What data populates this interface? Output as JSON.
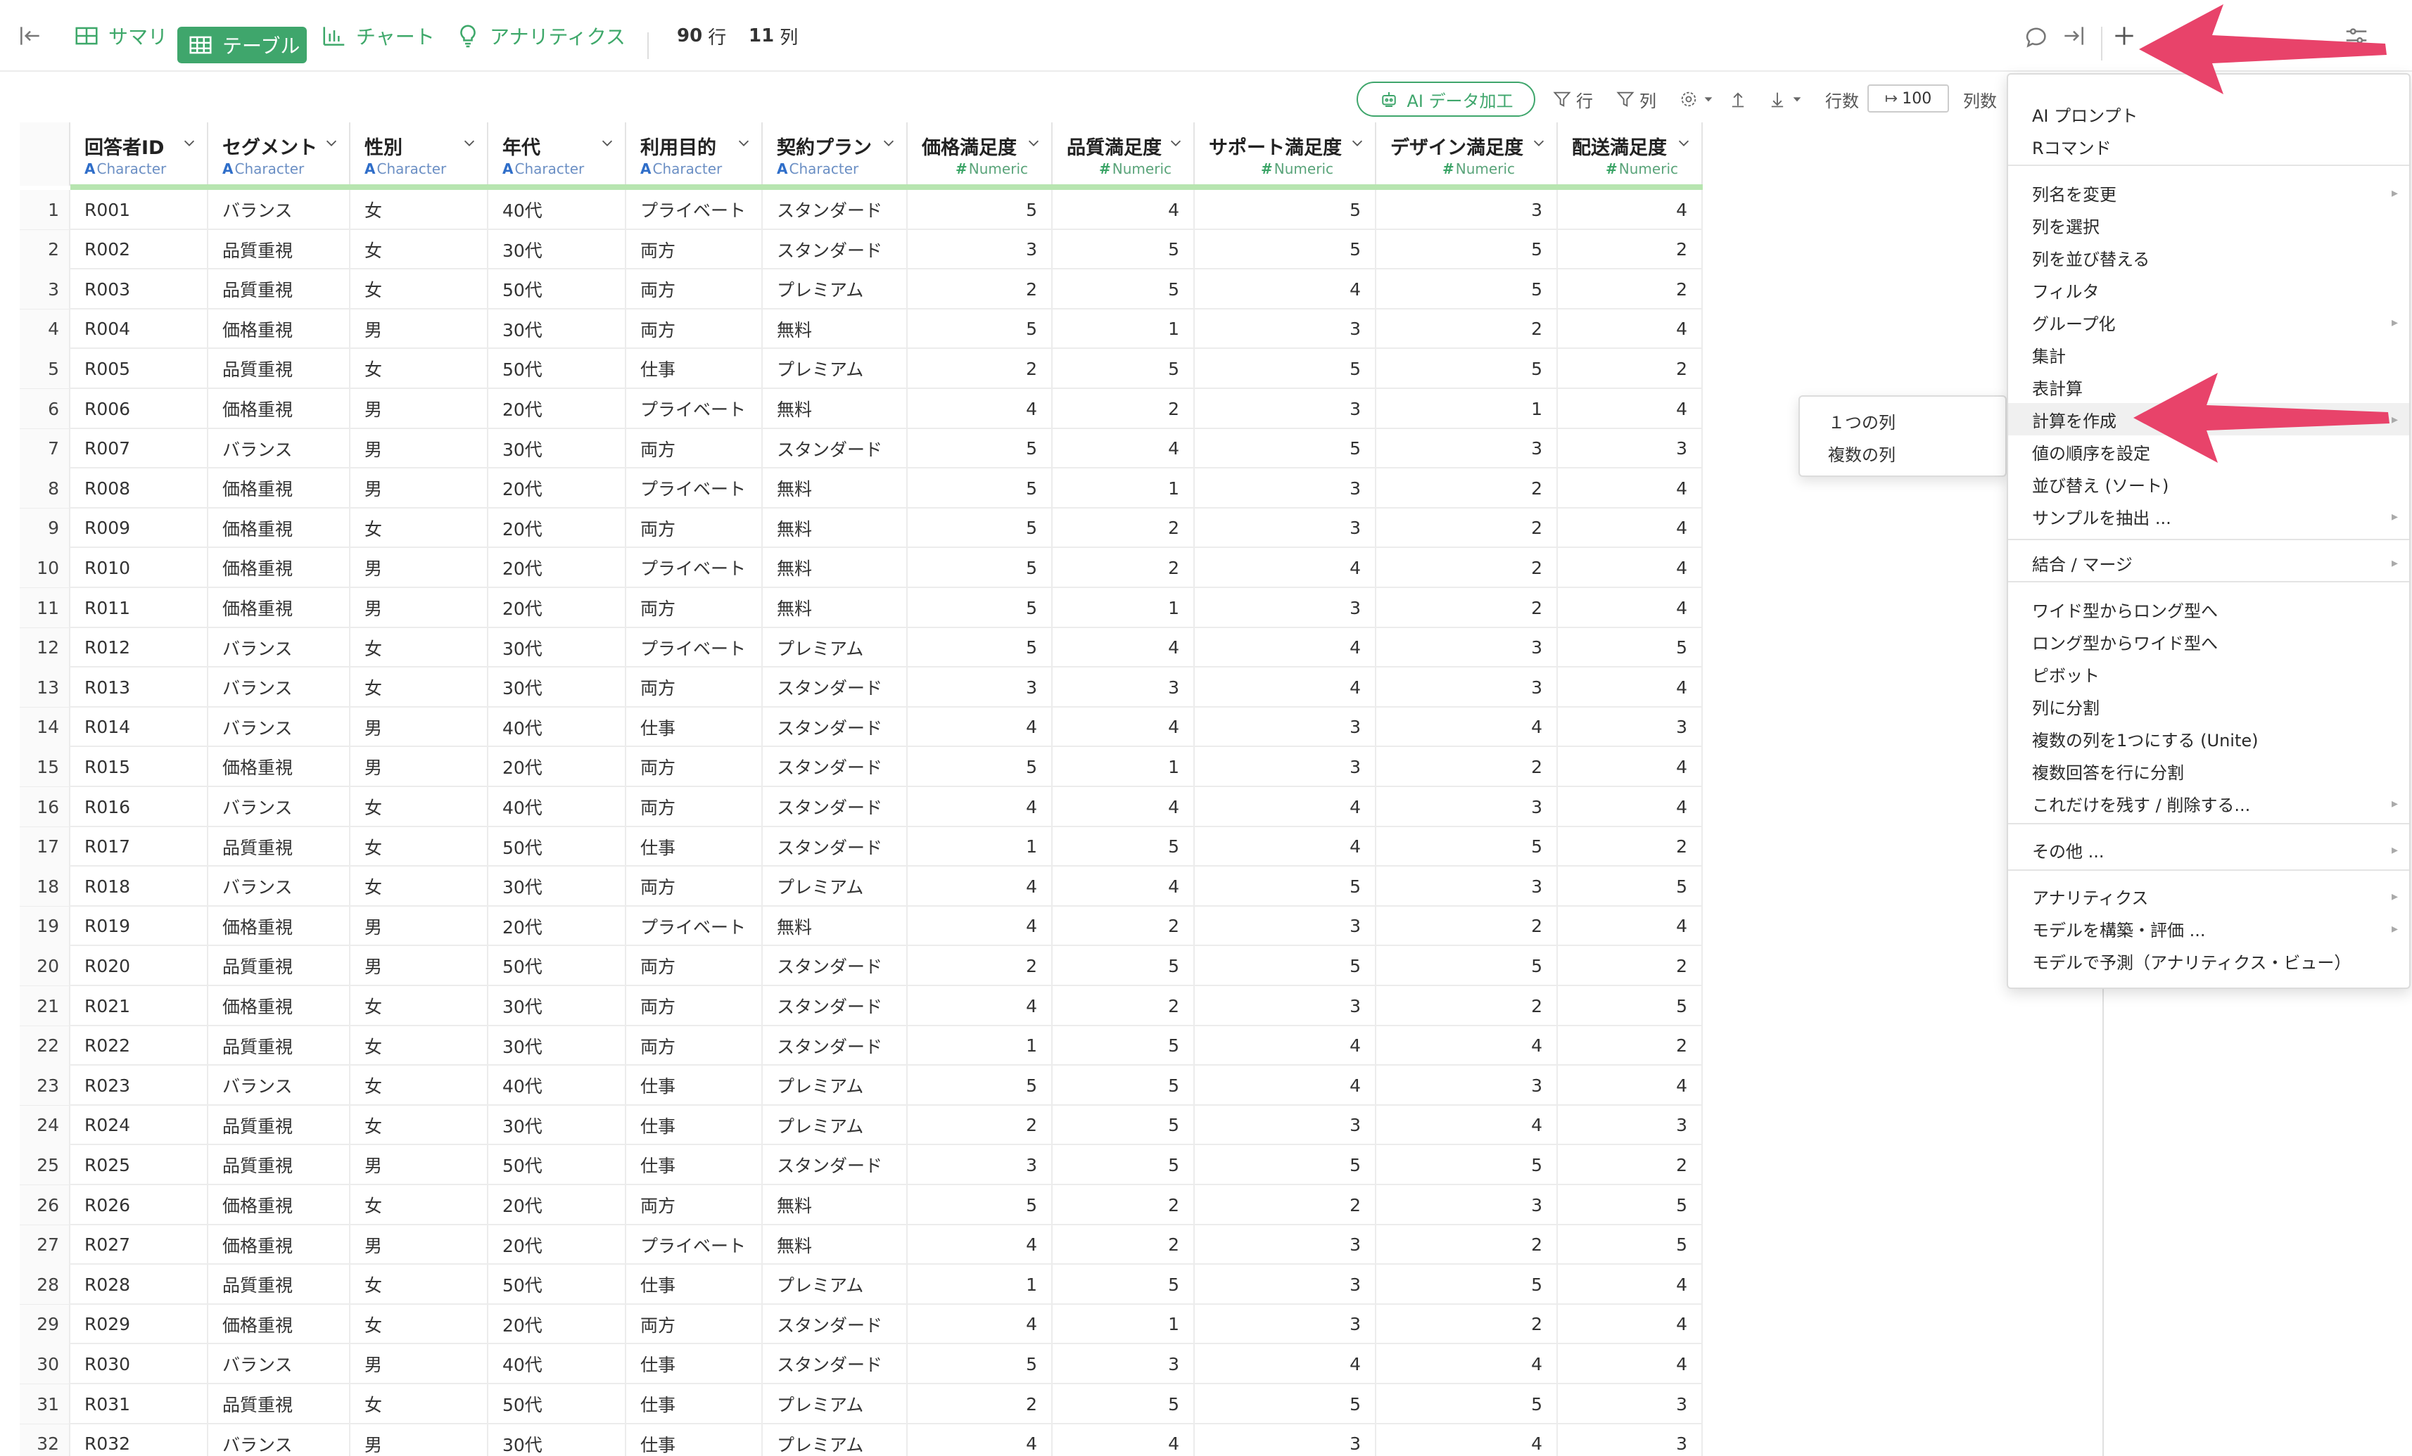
{
  "toolbar": {
    "summary_label": "サマリ",
    "table_label": "テーブル",
    "chart_label": "チャート",
    "analytics_label": "アナリティクス",
    "row_count": "90",
    "row_unit": "行",
    "col_count": "11",
    "col_unit": "列"
  },
  "toolbar2": {
    "ai_label": "AI データ加工",
    "filter_row": "行",
    "filter_col": "列",
    "rows_label": "行数",
    "rows_value": "100",
    "cols_label": "列数"
  },
  "columns": [
    {
      "name": "回答者ID",
      "type": "Character"
    },
    {
      "name": "セグメント",
      "type": "Character"
    },
    {
      "name": "性別",
      "type": "Character"
    },
    {
      "name": "年代",
      "type": "Character"
    },
    {
      "name": "利用目的",
      "type": "Character"
    },
    {
      "name": "契約プラン",
      "type": "Character"
    },
    {
      "name": "価格満足度",
      "type": "Numeric"
    },
    {
      "name": "品質満足度",
      "type": "Numeric"
    },
    {
      "name": "サポート満足度",
      "type": "Numeric"
    },
    {
      "name": "デザイン満足度",
      "type": "Numeric"
    },
    {
      "name": "配送満足度",
      "type": "Numeric"
    }
  ],
  "rows": [
    [
      "1",
      "R001",
      "バランス",
      "女",
      "40代",
      "プライベート",
      "スタンダード",
      "5",
      "4",
      "5",
      "3",
      "4"
    ],
    [
      "2",
      "R002",
      "品質重視",
      "女",
      "30代",
      "両方",
      "スタンダード",
      "3",
      "5",
      "5",
      "5",
      "2"
    ],
    [
      "3",
      "R003",
      "品質重視",
      "女",
      "50代",
      "両方",
      "プレミアム",
      "2",
      "5",
      "4",
      "5",
      "2"
    ],
    [
      "4",
      "R004",
      "価格重視",
      "男",
      "30代",
      "両方",
      "無料",
      "5",
      "1",
      "3",
      "2",
      "4"
    ],
    [
      "5",
      "R005",
      "品質重視",
      "女",
      "50代",
      "仕事",
      "プレミアム",
      "2",
      "5",
      "5",
      "5",
      "2"
    ],
    [
      "6",
      "R006",
      "価格重視",
      "男",
      "20代",
      "プライベート",
      "無料",
      "4",
      "2",
      "3",
      "1",
      "4"
    ],
    [
      "7",
      "R007",
      "バランス",
      "男",
      "30代",
      "両方",
      "スタンダード",
      "5",
      "4",
      "5",
      "3",
      "3"
    ],
    [
      "8",
      "R008",
      "価格重視",
      "男",
      "20代",
      "プライベート",
      "無料",
      "5",
      "1",
      "3",
      "2",
      "4"
    ],
    [
      "9",
      "R009",
      "価格重視",
      "女",
      "20代",
      "両方",
      "無料",
      "5",
      "2",
      "3",
      "2",
      "4"
    ],
    [
      "10",
      "R010",
      "価格重視",
      "男",
      "20代",
      "プライベート",
      "無料",
      "5",
      "2",
      "4",
      "2",
      "4"
    ],
    [
      "11",
      "R011",
      "価格重視",
      "男",
      "20代",
      "両方",
      "無料",
      "5",
      "1",
      "3",
      "2",
      "4"
    ],
    [
      "12",
      "R012",
      "バランス",
      "女",
      "30代",
      "プライベート",
      "プレミアム",
      "5",
      "4",
      "4",
      "3",
      "5"
    ],
    [
      "13",
      "R013",
      "バランス",
      "女",
      "30代",
      "両方",
      "スタンダード",
      "3",
      "3",
      "4",
      "3",
      "4"
    ],
    [
      "14",
      "R014",
      "バランス",
      "男",
      "40代",
      "仕事",
      "スタンダード",
      "4",
      "4",
      "3",
      "4",
      "3"
    ],
    [
      "15",
      "R015",
      "価格重視",
      "男",
      "20代",
      "両方",
      "スタンダード",
      "5",
      "1",
      "3",
      "2",
      "4"
    ],
    [
      "16",
      "R016",
      "バランス",
      "女",
      "40代",
      "両方",
      "スタンダード",
      "4",
      "4",
      "4",
      "3",
      "4"
    ],
    [
      "17",
      "R017",
      "品質重視",
      "女",
      "50代",
      "仕事",
      "スタンダード",
      "1",
      "5",
      "4",
      "5",
      "2"
    ],
    [
      "18",
      "R018",
      "バランス",
      "女",
      "30代",
      "両方",
      "プレミアム",
      "4",
      "4",
      "5",
      "3",
      "5"
    ],
    [
      "19",
      "R019",
      "価格重視",
      "男",
      "20代",
      "プライベート",
      "無料",
      "4",
      "2",
      "3",
      "2",
      "4"
    ],
    [
      "20",
      "R020",
      "品質重視",
      "男",
      "50代",
      "両方",
      "スタンダード",
      "2",
      "5",
      "5",
      "5",
      "2"
    ],
    [
      "21",
      "R021",
      "価格重視",
      "女",
      "30代",
      "両方",
      "スタンダード",
      "4",
      "2",
      "3",
      "2",
      "5"
    ],
    [
      "22",
      "R022",
      "品質重視",
      "女",
      "30代",
      "両方",
      "スタンダード",
      "1",
      "5",
      "4",
      "4",
      "2"
    ],
    [
      "23",
      "R023",
      "バランス",
      "女",
      "40代",
      "仕事",
      "プレミアム",
      "5",
      "5",
      "4",
      "3",
      "4"
    ],
    [
      "24",
      "R024",
      "品質重視",
      "女",
      "30代",
      "仕事",
      "プレミアム",
      "2",
      "5",
      "3",
      "4",
      "3"
    ],
    [
      "25",
      "R025",
      "品質重視",
      "男",
      "50代",
      "仕事",
      "スタンダード",
      "3",
      "5",
      "5",
      "5",
      "2"
    ],
    [
      "26",
      "R026",
      "価格重視",
      "女",
      "20代",
      "両方",
      "無料",
      "5",
      "2",
      "2",
      "3",
      "5"
    ],
    [
      "27",
      "R027",
      "価格重視",
      "男",
      "20代",
      "プライベート",
      "無料",
      "4",
      "2",
      "3",
      "2",
      "5"
    ],
    [
      "28",
      "R028",
      "品質重視",
      "女",
      "50代",
      "仕事",
      "プレミアム",
      "1",
      "5",
      "3",
      "5",
      "4"
    ],
    [
      "29",
      "R029",
      "価格重視",
      "女",
      "20代",
      "両方",
      "スタンダード",
      "4",
      "1",
      "3",
      "2",
      "4"
    ],
    [
      "30",
      "R030",
      "バランス",
      "男",
      "40代",
      "仕事",
      "スタンダード",
      "5",
      "3",
      "4",
      "4",
      "4"
    ],
    [
      "31",
      "R031",
      "品質重視",
      "女",
      "50代",
      "仕事",
      "プレミアム",
      "2",
      "5",
      "5",
      "5",
      "3"
    ],
    [
      "32",
      "R032",
      "バランス",
      "男",
      "30代",
      "仕事",
      "プレミアム",
      "4",
      "4",
      "3",
      "4",
      "3"
    ]
  ],
  "menu": {
    "items": [
      "AI プロンプト",
      "Rコマンド",
      "列名を変更",
      "列を選択",
      "列を並び替える",
      "フィルタ",
      "グループ化",
      "集計",
      "表計算",
      "計算を作成",
      "値の順序を設定",
      "並び替え (ソート)",
      "サンプルを抽出 ...",
      "結合 / マージ",
      "ワイド型からロング型へ",
      "ロング型からワイド型へ",
      "ピボット",
      "列に分割",
      "複数の列を1つにする (Unite)",
      "複数回答を行に分割",
      "これだけを残す / 削除する...",
      "その他 ...",
      "アナリティクス",
      "モデルを構築・評価 ...",
      "モデルで予測（アナリティクス・ビュー）"
    ]
  },
  "submenu": {
    "items": [
      "１つの列",
      "複数の列"
    ]
  },
  "colors": {
    "accent": "#3fa66c",
    "arrow": "#e8436a",
    "char_type": "#2f6ec9",
    "num_type": "#3aa466"
  }
}
